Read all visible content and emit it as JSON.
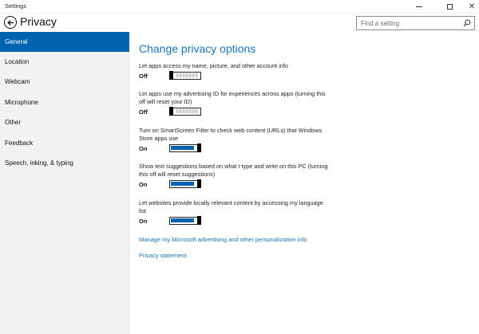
{
  "window": {
    "title": "Settings"
  },
  "header": {
    "title": "Privacy",
    "search_placeholder": "Find a setting"
  },
  "sidebar": {
    "items": [
      {
        "label": "General",
        "active": true
      },
      {
        "label": "Location"
      },
      {
        "label": "Webcam"
      },
      {
        "label": "Microphone"
      },
      {
        "label": "Other"
      },
      {
        "label": "Feedback"
      },
      {
        "label": "Speech, inking, & typing"
      }
    ]
  },
  "main": {
    "heading": "Change privacy options",
    "settings": [
      {
        "description": "Let apps access my name, picture, and other account info",
        "state": "Off"
      },
      {
        "description": "Let apps use my advertising ID for experiences across apps (turning this off will reset your ID)",
        "state": "Off"
      },
      {
        "description": "Turn on SmartScreen Filter to check web content (URLs) that Windows Store apps use",
        "state": "On"
      },
      {
        "description": "Show text suggestions based on what I type and write on this PC (turning this off will reset suggestions)",
        "state": "On"
      },
      {
        "description": "Let websites provide locally relevant content by accessing my language list",
        "state": "On"
      }
    ],
    "links": [
      "Manage my Microsoft advertising and other personalization info",
      "Privacy statement"
    ]
  },
  "colors": {
    "accent": "#0063b1",
    "link": "#1a73b8",
    "sidebar_bg": "#f2f2f2"
  }
}
